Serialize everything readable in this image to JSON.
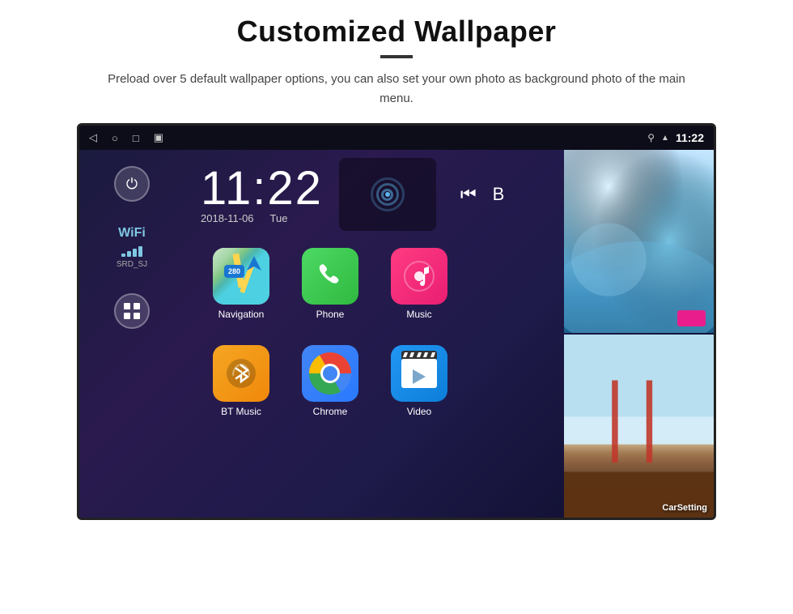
{
  "header": {
    "title": "Customized Wallpaper",
    "divider": true,
    "subtitle": "Preload over 5 default wallpaper options, you can also set your own photo as background photo of the main menu."
  },
  "device": {
    "status_bar": {
      "back_icon": "◁",
      "home_icon": "○",
      "recent_icon": "□",
      "screenshot_icon": "▣",
      "location_icon": "⚲",
      "wifi_icon": "▲",
      "time": "11:22"
    },
    "clock": {
      "time": "11:22",
      "date": "2018-11-06",
      "day": "Tue"
    },
    "wifi": {
      "label": "WiFi",
      "ssid": "SRD_SJ"
    },
    "apps": [
      {
        "id": "navigation",
        "label": "Navigation"
      },
      {
        "id": "phone",
        "label": "Phone"
      },
      {
        "id": "music",
        "label": "Music"
      },
      {
        "id": "btmusic",
        "label": "BT Music"
      },
      {
        "id": "chrome",
        "label": "Chrome"
      },
      {
        "id": "video",
        "label": "Video"
      }
    ],
    "wallpapers": [
      {
        "id": "ice-cave",
        "type": "ice"
      },
      {
        "id": "golden-gate",
        "label": "CarSetting",
        "type": "bridge"
      }
    ]
  }
}
